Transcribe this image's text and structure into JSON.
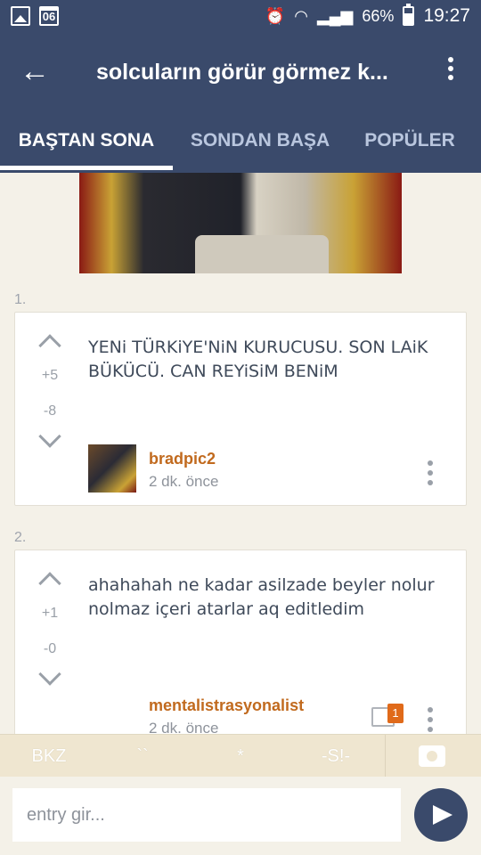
{
  "status_bar": {
    "battery": "66%",
    "time": "19:27",
    "calendar_day": "06"
  },
  "app_bar": {
    "title": "solcuların görür görmez k..."
  },
  "tabs": [
    {
      "label": "BAŞTAN SONA",
      "active": true
    },
    {
      "label": "SONDAN BAŞA",
      "active": false
    },
    {
      "label": "POPÜLER",
      "active": false
    }
  ],
  "entries": [
    {
      "number": "1.",
      "up_count": "+5",
      "down_count": "-8",
      "text": "YENi TÜRKiYE'NiN KURUCUSU. SON LAiK BÜKÜCÜ. CAN REYiSiM BENiM",
      "author": "bradpic2",
      "time": "2 dk. önce"
    },
    {
      "number": "2.",
      "up_count": "+1",
      "down_count": "-0",
      "text": "ahahahah ne kadar asilzade beyler nolur nolmaz içeri atarlar aq editledim",
      "author": "mentalistrasyonalist",
      "time": "2 dk. önce",
      "comment_count": "1"
    }
  ],
  "toolbar": {
    "items": [
      "BKZ",
      "``",
      "*",
      "-S!-"
    ]
  },
  "entry_bar": {
    "placeholder": "entry gir..."
  },
  "colors": {
    "primary": "#3a4a6b",
    "accent": "#c16a1e",
    "background": "#f4f1e8"
  }
}
